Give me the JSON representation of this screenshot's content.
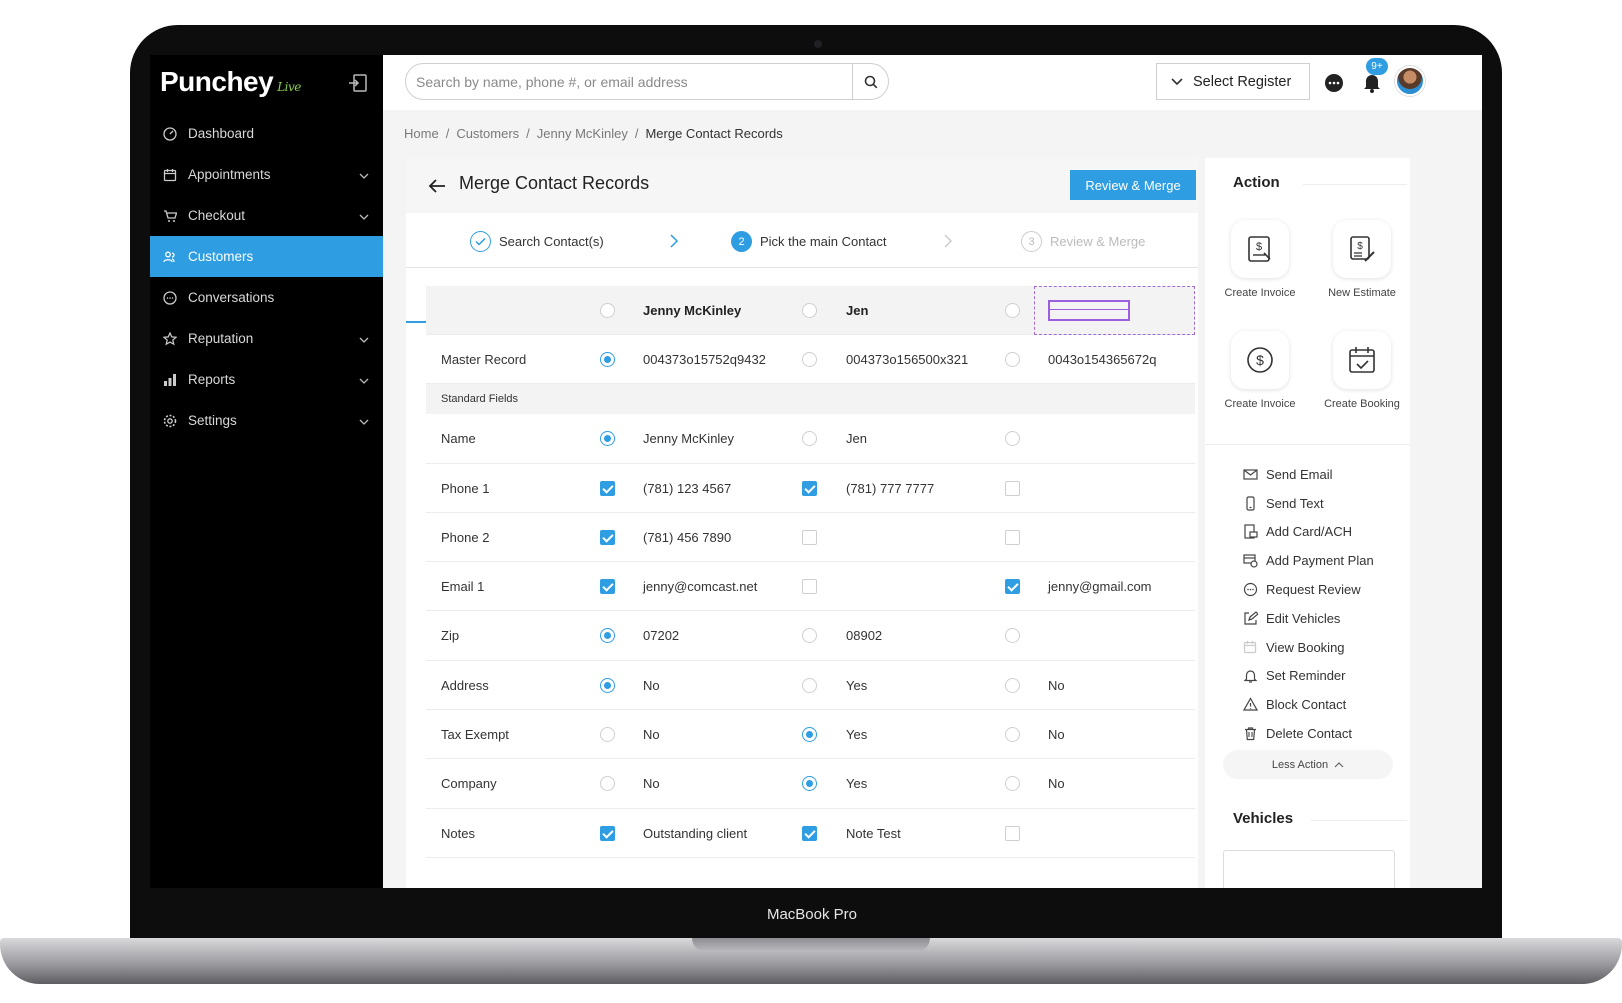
{
  "device": {
    "label": "MacBook Pro"
  },
  "brand": {
    "name": "Punchey",
    "sub": "Live",
    "accent": "#2f9de2",
    "live_color": "#8cd04a"
  },
  "sidebar": {
    "items": [
      {
        "label": "Dashboard",
        "icon": "dashboard-icon",
        "has_chevron": false,
        "active": false
      },
      {
        "label": "Appointments",
        "icon": "calendar-icon",
        "has_chevron": true,
        "active": false
      },
      {
        "label": "Checkout",
        "icon": "cart-icon",
        "has_chevron": true,
        "active": false
      },
      {
        "label": "Customers",
        "icon": "customers-icon",
        "has_chevron": false,
        "active": true
      },
      {
        "label": "Conversations",
        "icon": "chat-icon",
        "has_chevron": false,
        "active": false
      },
      {
        "label": "Reputation",
        "icon": "star-icon",
        "has_chevron": true,
        "active": false
      },
      {
        "label": "Reports",
        "icon": "bar-chart-icon",
        "has_chevron": true,
        "active": false
      },
      {
        "label": "Settings",
        "icon": "gear-icon",
        "has_chevron": true,
        "active": false
      }
    ]
  },
  "topbar": {
    "search_placeholder": "Search by name, phone #, or email address",
    "register_label": "Select Register",
    "notification_badge": "9+"
  },
  "breadcrumb": {
    "items": [
      "Home",
      "Customers",
      "Jenny McKinley"
    ],
    "current": "Merge Contact Records"
  },
  "main": {
    "title": "Merge Contact Records",
    "primary_button": "Review & Merge",
    "steps": [
      {
        "label": "Search Contact(s)",
        "marker": "✓",
        "state": "done"
      },
      {
        "label": "Pick the main Contact",
        "marker": "2",
        "state": "active"
      },
      {
        "label": "Review & Merge",
        "marker": "3",
        "state": "pending"
      }
    ],
    "header_row": {
      "col1": "Jenny McKinley",
      "col2": "Jen",
      "col3": ""
    },
    "section_label": "Standard Fields",
    "master_row": {
      "label": "Master Record",
      "values": [
        "004373o15752q9432",
        "004373o156500x321",
        "0043o154365672q"
      ],
      "controls": [
        "radio-on",
        "radio",
        "radio"
      ]
    },
    "rows": [
      {
        "label": "Name",
        "values": [
          "Jenny McKinley",
          "Jen",
          ""
        ],
        "controls": [
          "radio-on",
          "radio",
          "radio"
        ]
      },
      {
        "label": "Phone 1",
        "values": [
          "(781) 123 4567",
          "(781) 777 7777",
          ""
        ],
        "controls": [
          "check-on",
          "check-on",
          "check"
        ]
      },
      {
        "label": "Phone 2",
        "values": [
          "(781) 456 7890",
          "",
          ""
        ],
        "controls": [
          "check-on",
          "check",
          "check"
        ]
      },
      {
        "label": "Email 1",
        "values": [
          "jenny@comcast.net",
          "",
          "jenny@gmail.com"
        ],
        "controls": [
          "check-on",
          "check",
          "check-on"
        ]
      },
      {
        "label": "Zip",
        "values": [
          "07202",
          " 08902",
          ""
        ],
        "controls": [
          "radio-on",
          "radio",
          "radio"
        ]
      },
      {
        "label": "Address",
        "values": [
          "No",
          "Yes",
          "No"
        ],
        "controls": [
          "radio-on",
          "radio",
          "radio"
        ]
      },
      {
        "label": "Tax Exempt",
        "values": [
          "No",
          "Yes",
          "No"
        ],
        "controls": [
          "radio",
          "radio-on",
          "radio"
        ]
      },
      {
        "label": "Company",
        "values": [
          "No",
          "Yes",
          "No"
        ],
        "controls": [
          "radio",
          "radio-on",
          "radio"
        ]
      },
      {
        "label": "Notes",
        "values": [
          "Outstanding client",
          "Note Test",
          ""
        ],
        "controls": [
          "check-on",
          "check-on",
          "check"
        ]
      }
    ]
  },
  "panel": {
    "title": "Action",
    "tiles": [
      {
        "label": "Create Invoice",
        "icon": "invoice-icon"
      },
      {
        "label": "New Estimate",
        "icon": "estimate-icon"
      },
      {
        "label": "Create Invoice",
        "icon": "dollar-circle-icon"
      },
      {
        "label": "Create Booking",
        "icon": "booking-calendar-icon"
      }
    ],
    "actions": [
      {
        "label": "Send Email",
        "icon": "envelope-icon"
      },
      {
        "label": "Send Text",
        "icon": "phone-icon"
      },
      {
        "label": "Add Card/ACH",
        "icon": "card-icon"
      },
      {
        "label": "Add Payment Plan",
        "icon": "payment-plan-icon"
      },
      {
        "label": "Request Review",
        "icon": "review-icon"
      },
      {
        "label": "Edit Vehicles",
        "icon": "edit-icon"
      },
      {
        "label": "View Booking",
        "icon": "calendar-icon"
      },
      {
        "label": "Set Reminder",
        "icon": "bell-icon"
      },
      {
        "label": "Block Contact",
        "icon": "warning-icon"
      },
      {
        "label": "Delete Contact",
        "icon": "trash-icon"
      }
    ],
    "less_label": "Less Action",
    "vehicles_title": "Vehicles"
  }
}
